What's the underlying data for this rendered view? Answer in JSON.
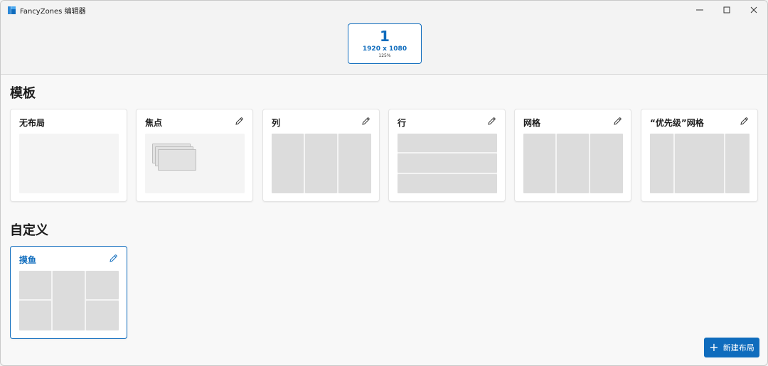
{
  "window": {
    "title": "FancyZones 编辑器",
    "controls": {
      "minimize": "minimize-icon",
      "maximize": "maximize-icon",
      "close": "close-icon"
    }
  },
  "monitor": {
    "number": "1",
    "resolution": "1920 x 1080",
    "scale": "125%"
  },
  "templates": {
    "heading": "模板",
    "cards": [
      {
        "label": "无布局"
      },
      {
        "label": "焦点"
      },
      {
        "label": "列"
      },
      {
        "label": "行"
      },
      {
        "label": "网格"
      },
      {
        "label": "“优先级”网格"
      }
    ]
  },
  "custom": {
    "heading": "自定义",
    "cards": [
      {
        "label": "摸鱼"
      }
    ]
  },
  "new_layout_button": {
    "label": "新建布局"
  },
  "colors": {
    "accent": "#0f6cbd",
    "zone": "#dcdcdc",
    "preview_bg": "#f4f4f4"
  }
}
